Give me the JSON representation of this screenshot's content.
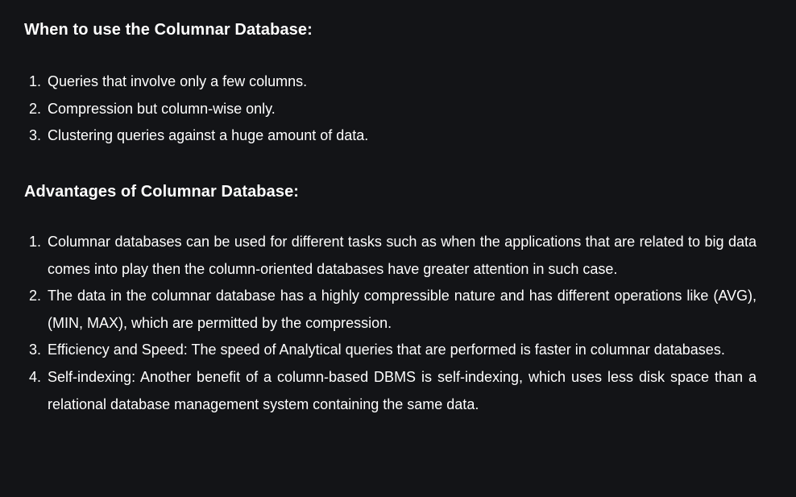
{
  "sections": [
    {
      "heading": "When to use the Columnar Database:",
      "items": [
        {
          "num": "1.",
          "text": "Queries that involve only a few columns."
        },
        {
          "num": "2.",
          "text": "Compression but column-wise only."
        },
        {
          "num": "3.",
          "text": "Clustering queries against a huge amount of data."
        }
      ]
    },
    {
      "heading": "Advantages of Columnar Database:",
      "items": [
        {
          "num": "1.",
          "text": "Columnar databases can be used for different tasks such as when the applications that are related to big data comes into play then the column-oriented databases have greater attention in such case."
        },
        {
          "num": "2.",
          "text": "The data in the columnar database has a highly compressible nature and has different operations like (AVG), (MIN, MAX), which are permitted by the compression."
        },
        {
          "num": "3.",
          "text": "Efficiency and Speed: The speed of Analytical queries that are performed is faster in columnar databases."
        },
        {
          "num": "4.",
          "text": "Self-indexing: Another benefit of a column-based DBMS is self-indexing, which uses less disk space than a relational database management system containing the same data."
        }
      ]
    }
  ],
  "colors": {
    "background": "#131417",
    "text": "#ffffff"
  }
}
